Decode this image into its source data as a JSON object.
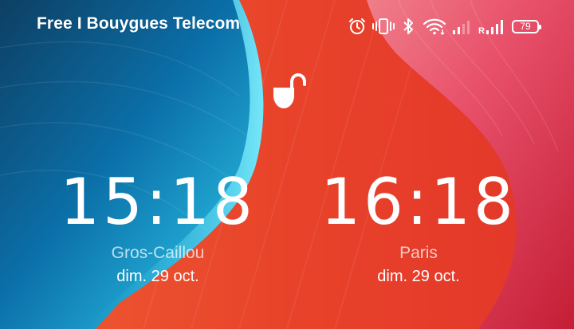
{
  "status_bar": {
    "carrier": "Free I Bouygues Telecom",
    "icons": [
      "alarm-icon",
      "vibrate-icon",
      "bluetooth-icon",
      "wifi-icon",
      "signal-icon",
      "roaming-signal-icon"
    ],
    "roaming_label": "R",
    "battery_level": "79"
  },
  "lock": {
    "icon": "unlocked-padlock-icon"
  },
  "clocks": [
    {
      "time": "15:18",
      "city": "Gros-Caillou",
      "date": "dim. 29 oct."
    },
    {
      "time": "16:18",
      "city": "Paris",
      "date": "dim. 29 oct."
    }
  ],
  "colors": {
    "background_red": "#e8452c",
    "wave_blue": "#0b6fa8",
    "wave_cyan": "#2fc6e6",
    "wave_pink": "#e8506a"
  }
}
